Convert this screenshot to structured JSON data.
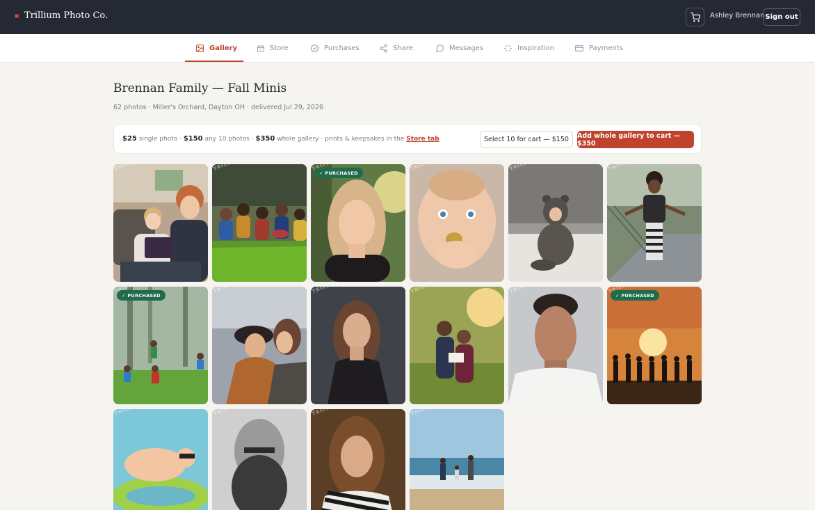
{
  "app": {
    "brand_name": "Trillium Photo Co.",
    "user_name": "Ashley Brennan",
    "signout_label": "Sign out",
    "cart_icon": "cart-icon",
    "accent_color": "#c0432d"
  },
  "nav": {
    "tabs": [
      {
        "label": "Gallery",
        "icon": "image-icon",
        "active": true
      },
      {
        "label": "Store",
        "icon": "store-icon",
        "active": false
      },
      {
        "label": "Purchases",
        "icon": "check-circle-icon",
        "active": false
      },
      {
        "label": "Share",
        "icon": "share-icon",
        "active": false
      },
      {
        "label": "Messages",
        "icon": "message-icon",
        "active": false
      },
      {
        "label": "Inspiration",
        "icon": "sparkle-icon",
        "active": false
      },
      {
        "label": "Payments",
        "icon": "card-icon",
        "active": false
      }
    ]
  },
  "page": {
    "title": "Brennan Family — Fall Minis",
    "subtitle": "62 photos · Miller's Orchard, Dayton OH · delivered Jul 29, 2026"
  },
  "pricing": {
    "single_price": "$25",
    "single_label": "single photo ·",
    "ten_price": "$150",
    "ten_label": "any 10 photos ·",
    "gallery_price": "$350",
    "gallery_label": "whole gallery · prints & keepsakes in the",
    "store_link": "Store tab",
    "select10_label": "Select 10 for cart — $150",
    "add_gallery_label": "Add whole gallery to cart — $350"
  },
  "gallery": {
    "watermark": "© TRILLIUM PHOTO CO.",
    "badge_label": "PURCHASED",
    "photos": [
      {
        "scene": "family-tablet",
        "purchased": false
      },
      {
        "scene": "kids-grass",
        "purchased": false
      },
      {
        "scene": "woman-portrait",
        "purchased": true
      },
      {
        "scene": "baby-closeup",
        "purchased": false
      },
      {
        "scene": "toddler-bear-suit",
        "purchased": false
      },
      {
        "scene": "girl-bridge",
        "purchased": false
      },
      {
        "scene": "kids-forest",
        "purchased": true
      },
      {
        "scene": "women-laughing",
        "purchased": false
      },
      {
        "scene": "woman-dark",
        "purchased": false
      },
      {
        "scene": "kids-reading",
        "purchased": false
      },
      {
        "scene": "man-smiling",
        "purchased": false
      },
      {
        "scene": "sunset-silhouettes",
        "purchased": true
      },
      {
        "scene": "baby-pool",
        "purchased": false
      },
      {
        "scene": "bearded-man",
        "purchased": false
      },
      {
        "scene": "woman-striped",
        "purchased": false
      },
      {
        "scene": "beach-family",
        "purchased": false
      }
    ]
  }
}
